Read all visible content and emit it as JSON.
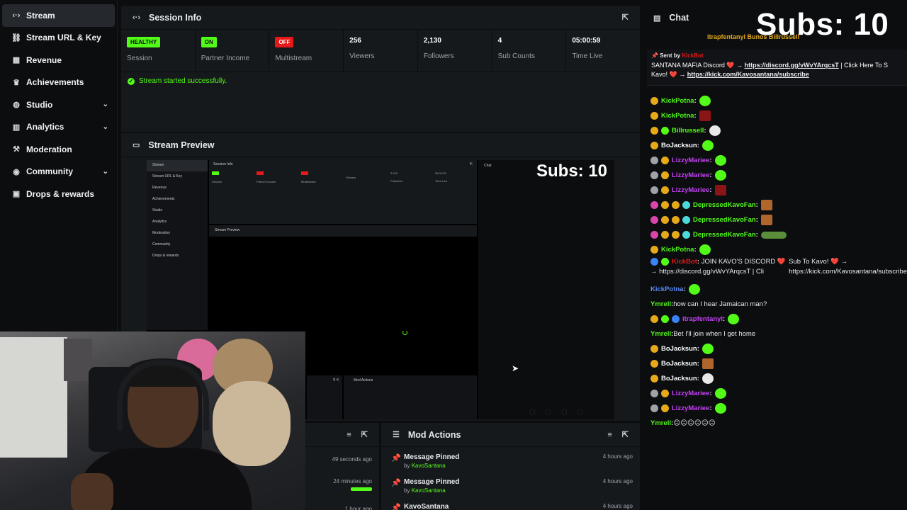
{
  "sidebar": {
    "items": [
      {
        "label": "Stream",
        "icon": "stream-icon",
        "active": true,
        "has_chevron": false
      },
      {
        "label": "Stream URL & Key",
        "icon": "link-icon",
        "has_chevron": false
      },
      {
        "label": "Revenue",
        "icon": "revenue-icon",
        "has_chevron": false
      },
      {
        "label": "Achievements",
        "icon": "trophy-icon",
        "has_chevron": false
      },
      {
        "label": "Studio",
        "icon": "studio-icon",
        "has_chevron": true
      },
      {
        "label": "Analytics",
        "icon": "analytics-icon",
        "has_chevron": true
      },
      {
        "label": "Moderation",
        "icon": "gavel-icon",
        "has_chevron": false
      },
      {
        "label": "Community",
        "icon": "community-icon",
        "has_chevron": true
      },
      {
        "label": "Drops & rewards",
        "icon": "gift-icon",
        "has_chevron": false
      }
    ]
  },
  "session": {
    "title": "Session Info",
    "stats": [
      {
        "badge": "HEALTHY",
        "badge_color": "green",
        "label": "Session"
      },
      {
        "badge": "ON",
        "badge_color": "green",
        "label": "Partner Income"
      },
      {
        "badge": "OFF",
        "badge_color": "red",
        "label": "Multistream"
      },
      {
        "value": "256",
        "label": "Viewers"
      },
      {
        "value": "2,130",
        "label": "Followers"
      },
      {
        "value": "4",
        "label": "Sub Counts"
      },
      {
        "value": "05:00:59",
        "label": "Time Live"
      }
    ],
    "success_message": "Stream started successfully."
  },
  "preview": {
    "title": "Stream Preview",
    "mini": {
      "session_title": "Session Info",
      "chat_title": "Chat",
      "stream_preview_title": "Stream Preview",
      "subs": "Subs: 10",
      "mod_actions": "Mod Actions",
      "nav": [
        "Stream",
        "Stream URL & Key",
        "Revenue",
        "Achievements",
        "Studio",
        "Analytics",
        "Moderation",
        "Community",
        "Drops & rewards"
      ],
      "stats": [
        {
          "value": "",
          "label": "Session"
        },
        {
          "value": "",
          "label": "Partner Income"
        },
        {
          "value": "",
          "label": "Multistream"
        },
        {
          "value": "",
          "label": "Viewers"
        },
        {
          "value": "2,130",
          "label": "Followers"
        },
        {
          "value": "05:00:55",
          "label": "Time Live"
        }
      ]
    }
  },
  "activity": {
    "rows": [
      {
        "time": "49 seconds ago"
      },
      {
        "time": "24 minutes ago"
      },
      {
        "time": "1 hour ago"
      }
    ]
  },
  "mod_actions": {
    "title": "Mod Actions",
    "rows": [
      {
        "action": "Message Pinned",
        "by": "by",
        "user": "KavoSantana",
        "time": "4 hours ago"
      },
      {
        "action": "Message Pinned",
        "by": "by",
        "user": "KavoSantana",
        "time": "4 hours ago"
      },
      {
        "action": "KavoSantana",
        "by": "",
        "user": "",
        "time": "4 hours ago"
      }
    ]
  },
  "chat": {
    "title": "Chat",
    "subs_overlay": "Subs: 10",
    "top_users": "itrapfentanyl    Bunos    Billrussell",
    "pinned": {
      "sent_by": "Sent by",
      "bot": "KickBot",
      "line1_text": "SANTANA MAFIA Discord ❤️ → ",
      "line1_link": "https://discord.gg/vWvYArqcsT",
      "line1_tail": " | Click Here To S",
      "line2_text": "Kavo! ❤️ → ",
      "line2_link": "https://kick.com/Kavosantana/subscribe"
    },
    "messages": [
      {
        "user": "KickPotna",
        "color": "#53fc18",
        "badges": [
          "#e5a91a"
        ],
        "text": "",
        "emote": "green"
      },
      {
        "user": "KickPotna",
        "color": "#53fc18",
        "badges": [
          "#e5a91a"
        ],
        "text": "",
        "emote": "red"
      },
      {
        "user": "Billrussell",
        "color": "#53fc18",
        "badges": [
          "#e5a91a",
          "#53fc18"
        ],
        "text": "",
        "emote": "white"
      },
      {
        "user": "BoJacksun",
        "color": "#ffffff",
        "badges": [
          "#e5a91a"
        ],
        "text": "",
        "emote": "green"
      },
      {
        "user": "LizzyMariee",
        "color": "#c542f5",
        "badges": [
          "#9ea3a9",
          "#e5a91a"
        ],
        "text": "",
        "emote": "green"
      },
      {
        "user": "LizzyMariee",
        "color": "#c542f5",
        "badges": [
          "#9ea3a9",
          "#e5a91a"
        ],
        "text": "",
        "emote": "green"
      },
      {
        "user": "LizzyMariee",
        "color": "#c542f5",
        "badges": [
          "#9ea3a9",
          "#e5a91a"
        ],
        "text": "",
        "emote": "red"
      },
      {
        "user": "DepressedKavoFan",
        "color": "#53fc18",
        "badges": [
          "#d946a8",
          "#e5a91a",
          "#e5a91a",
          "#4dd9d9"
        ],
        "text": "",
        "emote": "brown"
      },
      {
        "user": "DepressedKavoFan",
        "color": "#53fc18",
        "badges": [
          "#d946a8",
          "#e5a91a",
          "#e5a91a",
          "#4dd9d9"
        ],
        "text": "",
        "emote": "brown"
      },
      {
        "user": "DepressedKavoFan",
        "color": "#53fc18",
        "badges": [
          "#d946a8",
          "#e5a91a",
          "#e5a91a",
          "#4dd9d9"
        ],
        "text": "",
        "emote": "pepe"
      },
      {
        "user": "KickPotna",
        "color": "#53fc18",
        "badges": [
          "#e5a91a"
        ],
        "text": "",
        "emote": "green"
      },
      {
        "user": "KickBot",
        "color": "#e5191a",
        "badges": [
          "#3b82f6",
          "#53fc18"
        ],
        "text": "JOIN KAVO'S DISCORD ❤️ → https://discord.gg/vWvYArqcsT | Cli",
        "text2": "Sub To Kavo! ❤️ → https://kick.com/Kavosantana/subscribe",
        "tall": true,
        "emote": ""
      },
      {
        "user": "KickPotna",
        "color": "#5c8cf5",
        "badges": [],
        "text": "",
        "emote": "green"
      },
      {
        "user": "Ymrell",
        "color": "#53fc18",
        "badges": [],
        "text": "how can I hear Jamaican man?",
        "emote": ""
      },
      {
        "user": "itrapfentanyl",
        "color": "#c542f5",
        "badges": [
          "#e5a91a",
          "#53fc18",
          "#3b82f6"
        ],
        "text": "",
        "emote": "green"
      },
      {
        "user": "Ymrell",
        "color": "#53fc18",
        "badges": [],
        "text": "Bet I'll join when I get home",
        "emote": ""
      },
      {
        "user": "BoJacksun",
        "color": "#ffffff",
        "badges": [
          "#e5a91a"
        ],
        "text": "",
        "emote": "green"
      },
      {
        "user": "BoJacksun",
        "color": "#ffffff",
        "badges": [
          "#e5a91a"
        ],
        "text": "",
        "emote": "brown"
      },
      {
        "user": "BoJacksun",
        "color": "#ffffff",
        "badges": [
          "#e5a91a"
        ],
        "text": "",
        "emote": "white"
      },
      {
        "user": "LizzyMariee",
        "color": "#c542f5",
        "badges": [
          "#9ea3a9",
          "#e5a91a"
        ],
        "text": "",
        "emote": "green"
      },
      {
        "user": "LizzyMariee",
        "color": "#c542f5",
        "badges": [
          "#9ea3a9",
          "#e5a91a"
        ],
        "text": "",
        "emote": "green"
      },
      {
        "user": "Ymrell",
        "color": "#53fc18",
        "badges": [],
        "text": "☹☹☹☹☹☹",
        "emote": ""
      }
    ]
  }
}
